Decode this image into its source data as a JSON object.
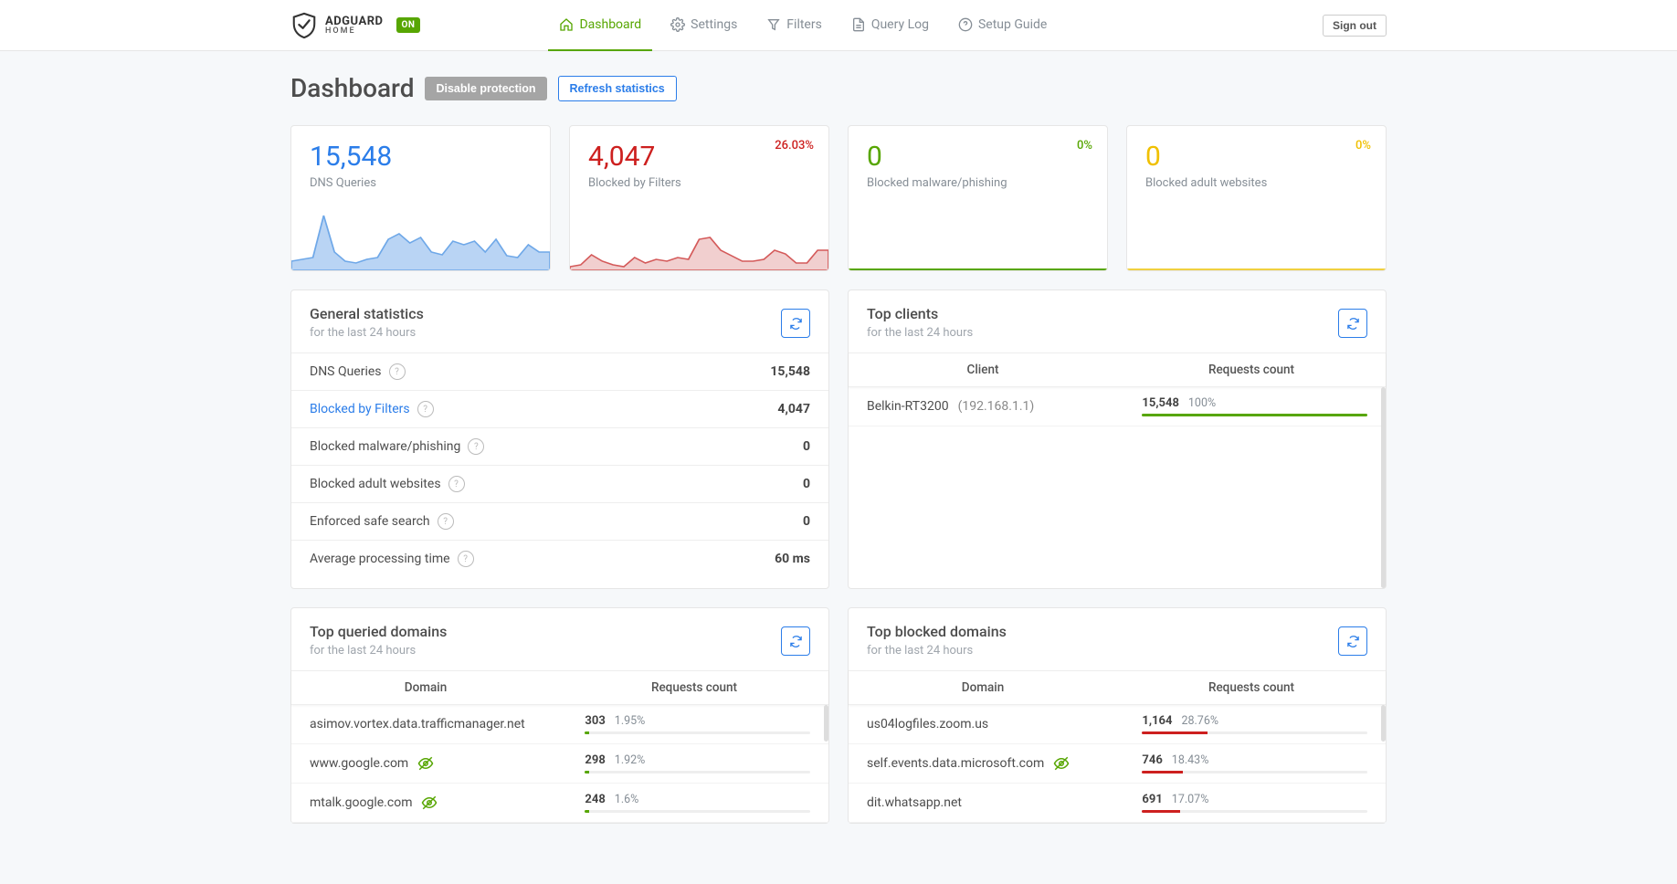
{
  "header": {
    "brand1": "ADGUARD",
    "brand2": "HOME",
    "on_badge": "ON",
    "nav": {
      "dashboard": "Dashboard",
      "settings": "Settings",
      "filters": "Filters",
      "query_log": "Query Log",
      "setup_guide": "Setup Guide"
    },
    "sign_out": "Sign out"
  },
  "page_title": "Dashboard",
  "buttons": {
    "disable_protection": "Disable protection",
    "refresh_statistics": "Refresh statistics"
  },
  "stats": {
    "dns_queries": {
      "value": "15,548",
      "label": "DNS Queries"
    },
    "blocked_filters": {
      "value": "4,047",
      "label": "Blocked by Filters",
      "pct": "26.03%"
    },
    "blocked_malware": {
      "value": "0",
      "label": "Blocked malware/phishing",
      "pct": "0%"
    },
    "blocked_adult": {
      "value": "0",
      "label": "Blocked adult websites",
      "pct": "0%"
    }
  },
  "general_stats": {
    "title": "General statistics",
    "sub": "for the last 24 hours",
    "rows": {
      "dns_queries": {
        "label": "DNS Queries",
        "value": "15,548"
      },
      "blocked_filters": {
        "label": "Blocked by Filters",
        "value": "4,047"
      },
      "blocked_malware": {
        "label": "Blocked malware/phishing",
        "value": "0"
      },
      "blocked_adult": {
        "label": "Blocked adult websites",
        "value": "0"
      },
      "safe_search": {
        "label": "Enforced safe search",
        "value": "0"
      },
      "avg_time": {
        "label": "Average processing time",
        "value": "60 ms"
      }
    }
  },
  "top_clients": {
    "title": "Top clients",
    "sub": "for the last 24 hours",
    "col1": "Client",
    "col2": "Requests count",
    "rows": [
      {
        "name": "Belkin-RT3200",
        "ip": "(192.168.1.1)",
        "count": "15,548",
        "pct": "100%",
        "bar": 100
      }
    ]
  },
  "top_queried": {
    "title": "Top queried domains",
    "sub": "for the last 24 hours",
    "col1": "Domain",
    "col2": "Requests count",
    "rows": [
      {
        "domain": "asimov.vortex.data.trafficmanager.net",
        "tracker": false,
        "count": "303",
        "pct": "1.95%",
        "bar": 2
      },
      {
        "domain": "www.google.com",
        "tracker": true,
        "count": "298",
        "pct": "1.92%",
        "bar": 2
      },
      {
        "domain": "mtalk.google.com",
        "tracker": true,
        "count": "248",
        "pct": "1.6%",
        "bar": 2
      }
    ]
  },
  "top_blocked": {
    "title": "Top blocked domains",
    "sub": "for the last 24 hours",
    "col1": "Domain",
    "col2": "Requests count",
    "rows": [
      {
        "domain": "us04logfiles.zoom.us",
        "tracker": false,
        "count": "1,164",
        "pct": "28.76%",
        "bar": 29
      },
      {
        "domain": "self.events.data.microsoft.com",
        "tracker": true,
        "count": "746",
        "pct": "18.43%",
        "bar": 18
      },
      {
        "domain": "dit.whatsapp.net",
        "tracker": false,
        "count": "691",
        "pct": "17.07%",
        "bar": 17
      }
    ]
  },
  "chart_data": [
    {
      "type": "area",
      "series_name": "DNS Queries",
      "color": "#6fa8e8",
      "values": [
        8,
        10,
        12,
        62,
        18,
        8,
        6,
        10,
        12,
        34,
        40,
        28,
        36,
        18,
        15,
        32,
        28,
        32,
        18,
        34,
        14,
        12,
        28,
        18
      ]
    },
    {
      "type": "area",
      "series_name": "Blocked by Filters",
      "color": "#cd201f",
      "values": [
        2,
        4,
        15,
        8,
        4,
        2,
        12,
        6,
        10,
        8,
        12,
        10,
        34,
        36,
        20,
        14,
        8,
        8,
        10,
        20,
        16,
        6,
        6,
        22
      ]
    }
  ]
}
